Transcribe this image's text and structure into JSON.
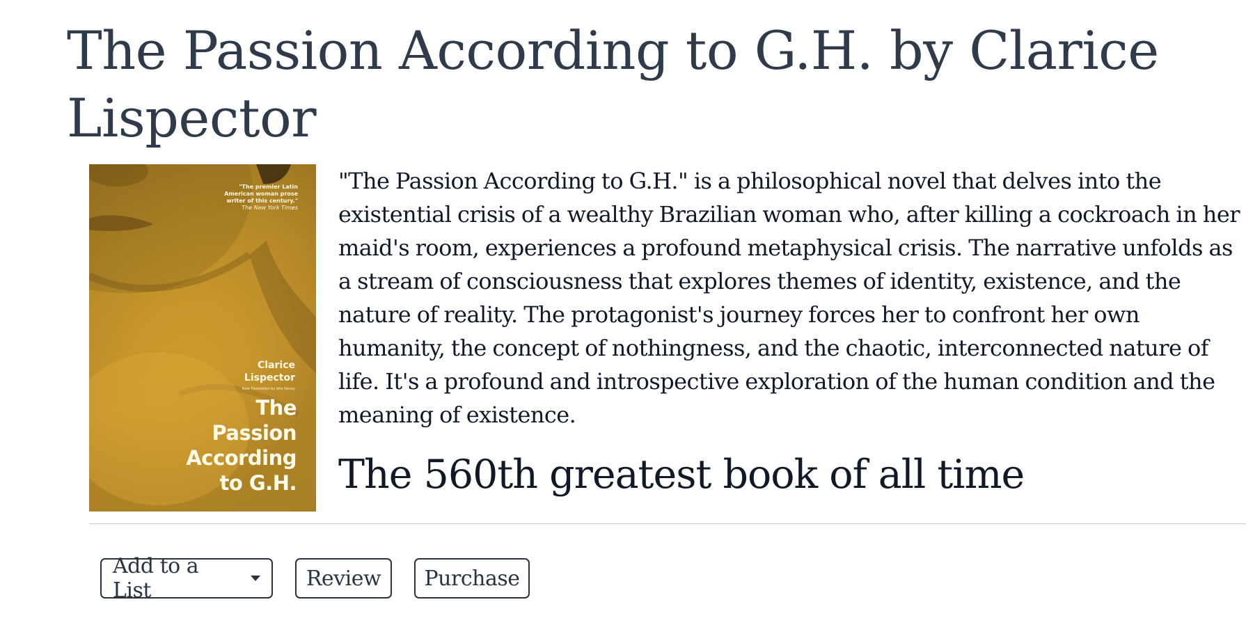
{
  "book": {
    "page_title": "The Passion According to G.H. by Clarice Lispector",
    "description": "\"The Passion According to G.H.\" is a philosophical novel that delves into the existential crisis of a wealthy Brazilian woman who, after killing a cockroach in her maid's room, experiences a profound metaphysical crisis. The narrative unfolds as a stream of consciousness that explores themes of identity, existence, and the nature of reality. The protagonist's journey forces her to confront her own humanity, the concept of nothingness, and the chaotic, interconnected nature of life. It's a profound and introspective exploration of the human condition and the meaning of existence.",
    "rank_text": "The 560th greatest book of all time"
  },
  "cover": {
    "quote_lines": [
      "\"The premier Latin",
      "American woman prose",
      "writer of this century.\""
    ],
    "quote_source": "The New York Times",
    "author_line1": "Clarice",
    "author_line2": "Lispector",
    "translator_line": "New Translation by Idra Novey",
    "title_lines": [
      "The",
      "Passion",
      "According",
      "to G.H."
    ],
    "colors": {
      "base": "#c99a2c",
      "text": "#fffbe9"
    }
  },
  "actions": {
    "add_to_list_label": "Add to a List",
    "review_label": "Review",
    "purchase_label": "Purchase"
  },
  "icons": {
    "dropdown": "chevron-down-icon"
  }
}
